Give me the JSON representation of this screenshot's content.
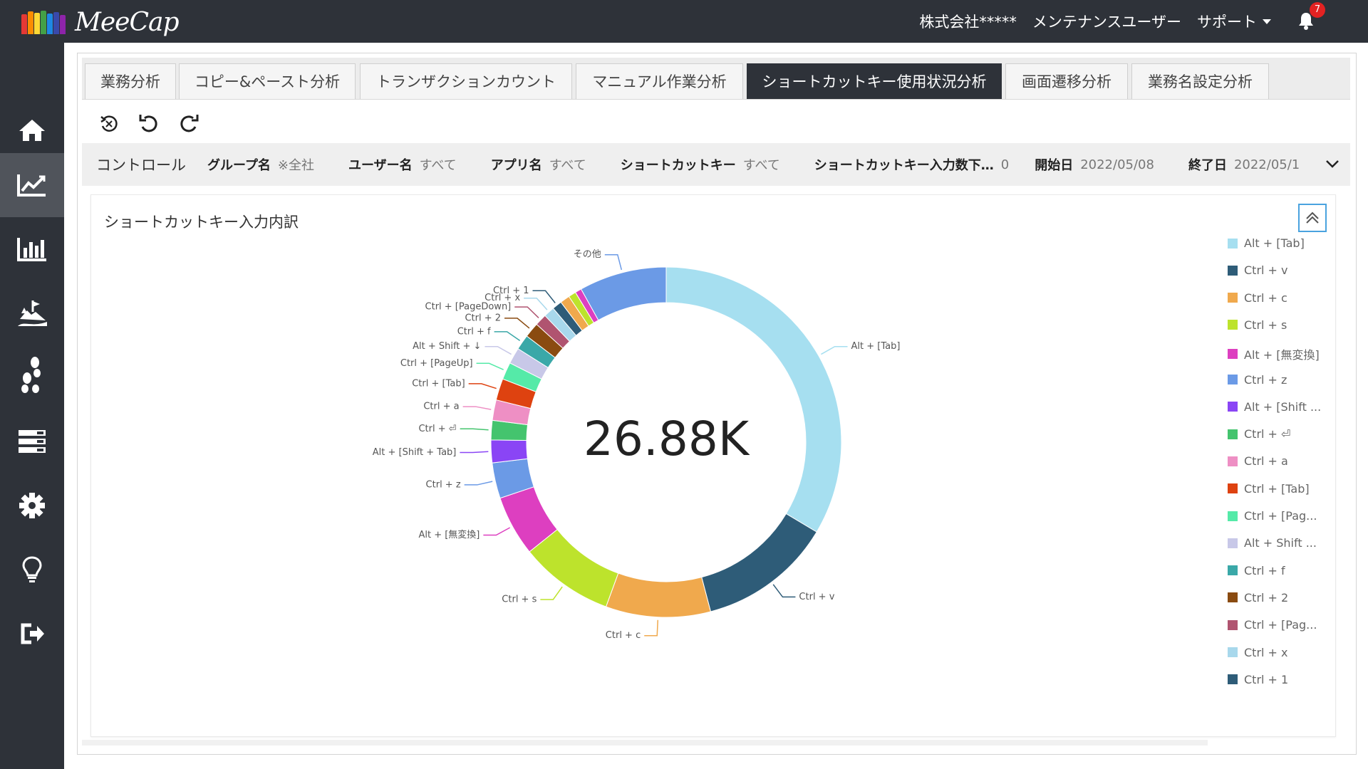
{
  "app": {
    "logo_text": "MeeCap"
  },
  "header": {
    "company": "株式会社*****",
    "user": "メンテナンスユーザー",
    "support": "サポート",
    "notification_count": "7"
  },
  "sidebar": {
    "items": [
      {
        "icon": "home-icon"
      },
      {
        "icon": "line-chart-icon",
        "active": true
      },
      {
        "icon": "bar-chart-icon"
      },
      {
        "icon": "landscape-icon"
      },
      {
        "icon": "footsteps-icon"
      },
      {
        "icon": "server-list-icon"
      },
      {
        "icon": "gear-icon"
      },
      {
        "icon": "lightbulb-icon"
      },
      {
        "icon": "logout-icon"
      }
    ]
  },
  "tabs": [
    {
      "label": "業務分析"
    },
    {
      "label": "コピー&ペースト分析"
    },
    {
      "label": "トランザクションカウント"
    },
    {
      "label": "マニュアル作業分析"
    },
    {
      "label": "ショートカットキー使用状況分析",
      "active": true
    },
    {
      "label": "画面遷移分析"
    },
    {
      "label": "業務名設定分析"
    }
  ],
  "toolbar": {
    "icons": [
      "reset-icon",
      "undo-icon",
      "redo-icon"
    ]
  },
  "controls": {
    "title": "コントロール",
    "group_label": "グループ名",
    "group_value": "※全社",
    "user_label": "ユーザー名",
    "user_value": "すべて",
    "app_label": "アプリ名",
    "app_value": "すべて",
    "key_label": "ショートカットキー",
    "key_value": "すべて",
    "count_label": "ショートカットキー入力数下…",
    "count_value": "0",
    "start_label": "開始日",
    "start_value": "2022/05/08",
    "end_label": "終了日",
    "end_value": "2022/05/1"
  },
  "chart_card": {
    "title": "ショートカットキー入力内訳"
  },
  "chart_data": {
    "type": "pie",
    "center_label": "26.88K",
    "slices": [
      {
        "label": "Alt + [Tab]",
        "value": 0.337,
        "color": "#a6dff0"
      },
      {
        "label": "Ctrl + v",
        "value": 0.124,
        "color": "#2e5c78"
      },
      {
        "label": "Ctrl + c",
        "value": 0.097,
        "color": "#f0a94d"
      },
      {
        "label": "Ctrl + s",
        "value": 0.087,
        "color": "#bde32c"
      },
      {
        "label": "Alt + [無変換]",
        "value": 0.056,
        "color": "#dd3fc0"
      },
      {
        "label": "Ctrl + z",
        "value": 0.033,
        "color": "#6b9ae6"
      },
      {
        "label": "Alt + [Shift + Tab]",
        "value": 0.021,
        "color": "#8a45f5"
      },
      {
        "label": "Ctrl + ⏎",
        "value": 0.018,
        "color": "#44c46e"
      },
      {
        "label": "Ctrl + a",
        "value": 0.019,
        "color": "#ee8fc4"
      },
      {
        "label": "Ctrl + [Tab]",
        "value": 0.02,
        "color": "#de4210"
      },
      {
        "label": "Ctrl + [PageUp]",
        "value": 0.016,
        "color": "#55eaa8"
      },
      {
        "label": "Alt + Shift + ↓",
        "value": 0.015,
        "color": "#c8c8e8"
      },
      {
        "label": "Ctrl + f",
        "value": 0.014,
        "color": "#3aa8a8"
      },
      {
        "label": "Ctrl + 2",
        "value": 0.014,
        "color": "#8a4b10"
      },
      {
        "label": "Ctrl + [PageDown]",
        "value": 0.011,
        "color": "#b05470"
      },
      {
        "label": "Ctrl + x",
        "value": 0.01,
        "color": "#a8d8ec"
      },
      {
        "label": "Ctrl + 1",
        "value": 0.009,
        "color": "#2e5c78"
      },
      {
        "label": "",
        "value": 0.009,
        "color": "#f0a94d"
      },
      {
        "label": "",
        "value": 0.007,
        "color": "#bde32c"
      },
      {
        "label": "",
        "value": 0.006,
        "color": "#dd3fc0"
      },
      {
        "label": "その他",
        "value": 0.081,
        "color": "#6b9ae6"
      }
    ],
    "legend": [
      {
        "label": "Alt + [Tab]",
        "color": "#a6dff0"
      },
      {
        "label": "Ctrl + v",
        "color": "#2e5c78"
      },
      {
        "label": "Ctrl + c",
        "color": "#f0a94d"
      },
      {
        "label": "Ctrl + s",
        "color": "#bde32c"
      },
      {
        "label": "Alt + [無変換]",
        "color": "#dd3fc0"
      },
      {
        "label": "Ctrl + z",
        "color": "#6b9ae6"
      },
      {
        "label": "Alt + [Shift ...",
        "color": "#8a45f5"
      },
      {
        "label": "Ctrl + ⏎",
        "color": "#44c46e"
      },
      {
        "label": "Ctrl + a",
        "color": "#ee8fc4"
      },
      {
        "label": "Ctrl + [Tab]",
        "color": "#de4210"
      },
      {
        "label": "Ctrl + [Pag...",
        "color": "#55eaa8"
      },
      {
        "label": "Alt + Shift ...",
        "color": "#c8c8e8"
      },
      {
        "label": "Ctrl + f",
        "color": "#3aa8a8"
      },
      {
        "label": "Ctrl + 2",
        "color": "#8a4b10"
      },
      {
        "label": "Ctrl + [Pag...",
        "color": "#b05470"
      },
      {
        "label": "Ctrl + x",
        "color": "#a8d8ec"
      },
      {
        "label": "Ctrl + 1",
        "color": "#2e5c78"
      }
    ]
  }
}
